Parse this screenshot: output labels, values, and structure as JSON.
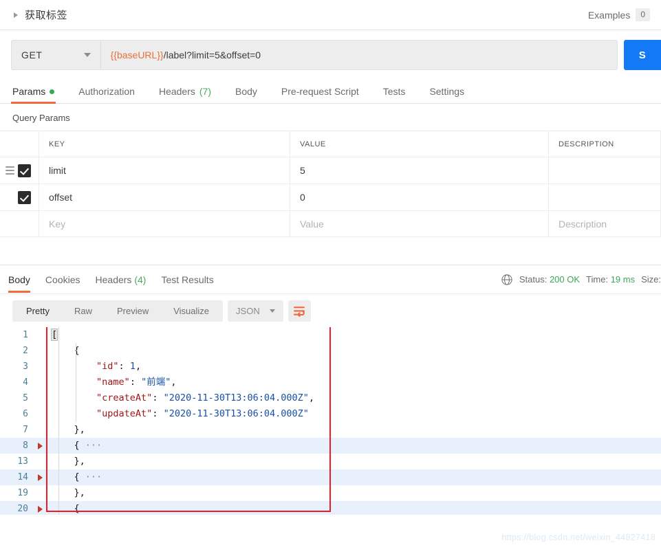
{
  "request": {
    "title": "获取标签",
    "examples_label": "Examples",
    "examples_count": "0",
    "method": "GET",
    "url_variable": "{{baseURL}}",
    "url_rest": "/label?limit=5&offset=0",
    "send_label": "S"
  },
  "request_tabs": [
    {
      "label": "Params",
      "dot": true,
      "active": true
    },
    {
      "label": "Authorization",
      "dot": false,
      "active": false
    },
    {
      "label": "Headers",
      "count": "(7)",
      "active": false
    },
    {
      "label": "Body",
      "active": false
    },
    {
      "label": "Pre-request Script",
      "active": false
    },
    {
      "label": "Tests",
      "active": false
    },
    {
      "label": "Settings",
      "active": false
    }
  ],
  "params": {
    "section_title": "Query Params",
    "headers": [
      "KEY",
      "VALUE",
      "DESCRIPTION"
    ],
    "rows": [
      {
        "checked": true,
        "drag": true,
        "key": "limit",
        "value": "5",
        "description": ""
      },
      {
        "checked": true,
        "drag": false,
        "key": "offset",
        "value": "0",
        "description": ""
      }
    ],
    "placeholder_row": {
      "key": "Key",
      "value": "Value",
      "description": "Description"
    }
  },
  "response_tabs": [
    {
      "label": "Body",
      "active": true
    },
    {
      "label": "Cookies",
      "active": false
    },
    {
      "label": "Headers",
      "count": "(4)",
      "active": false
    },
    {
      "label": "Test Results",
      "active": false
    }
  ],
  "response_meta": {
    "status_label": "Status:",
    "status_value": "200 OK",
    "time_label": "Time:",
    "time_value": "19 ms",
    "size_label": "Size:"
  },
  "body_toolbar": {
    "views": [
      "Pretty",
      "Raw",
      "Preview",
      "Visualize"
    ],
    "active_view": "Pretty",
    "format": "JSON",
    "wrap_icon": "word-wrap-icon"
  },
  "code": {
    "lines": [
      {
        "num": "1",
        "fold": false,
        "hl": false,
        "tokens": [
          {
            "t": "[",
            "c": "pun",
            "bracket": true
          }
        ]
      },
      {
        "num": "2",
        "fold": false,
        "hl": false,
        "tokens": [
          {
            "t": "    {",
            "c": "pun"
          }
        ]
      },
      {
        "num": "3",
        "fold": false,
        "hl": false,
        "tokens": [
          {
            "t": "        ",
            "c": "pun"
          },
          {
            "t": "\"id\"",
            "c": "key"
          },
          {
            "t": ": ",
            "c": "pun"
          },
          {
            "t": "1",
            "c": "num"
          },
          {
            "t": ",",
            "c": "pun"
          }
        ]
      },
      {
        "num": "4",
        "fold": false,
        "hl": false,
        "tokens": [
          {
            "t": "        ",
            "c": "pun"
          },
          {
            "t": "\"name\"",
            "c": "key"
          },
          {
            "t": ": ",
            "c": "pun"
          },
          {
            "t": "\"前端\"",
            "c": "str"
          },
          {
            "t": ",",
            "c": "pun"
          }
        ]
      },
      {
        "num": "5",
        "fold": false,
        "hl": false,
        "tokens": [
          {
            "t": "        ",
            "c": "pun"
          },
          {
            "t": "\"createAt\"",
            "c": "key"
          },
          {
            "t": ": ",
            "c": "pun"
          },
          {
            "t": "\"2020-11-30T13:06:04.000Z\"",
            "c": "str"
          },
          {
            "t": ",",
            "c": "pun"
          }
        ]
      },
      {
        "num": "6",
        "fold": false,
        "hl": false,
        "tokens": [
          {
            "t": "        ",
            "c": "pun"
          },
          {
            "t": "\"updateAt\"",
            "c": "key"
          },
          {
            "t": ": ",
            "c": "pun"
          },
          {
            "t": "\"2020-11-30T13:06:04.000Z\"",
            "c": "str"
          }
        ]
      },
      {
        "num": "7",
        "fold": false,
        "hl": false,
        "tokens": [
          {
            "t": "    },",
            "c": "pun"
          }
        ]
      },
      {
        "num": "8",
        "fold": true,
        "hl": true,
        "tokens": [
          {
            "t": "    { ",
            "c": "pun"
          },
          {
            "t": "···",
            "c": "ell"
          }
        ]
      },
      {
        "num": "13",
        "fold": false,
        "hl": false,
        "tokens": [
          {
            "t": "    },",
            "c": "pun"
          }
        ]
      },
      {
        "num": "14",
        "fold": true,
        "hl": true,
        "tokens": [
          {
            "t": "    { ",
            "c": "pun"
          },
          {
            "t": "···",
            "c": "ell"
          }
        ]
      },
      {
        "num": "19",
        "fold": false,
        "hl": false,
        "tokens": [
          {
            "t": "    },",
            "c": "pun"
          }
        ]
      },
      {
        "num": "20",
        "fold": true,
        "hl": true,
        "tokens": [
          {
            "t": "    {",
            "c": "pun"
          }
        ]
      }
    ]
  },
  "watermark": "https://blog.csdn.net/weixin_44827418",
  "colors": {
    "accent_orange": "#f26b3a",
    "send_blue": "#1479f5",
    "status_green": "#3aa757",
    "redbox": "#ef1b24",
    "highlight_row": "#e7f0fb"
  }
}
